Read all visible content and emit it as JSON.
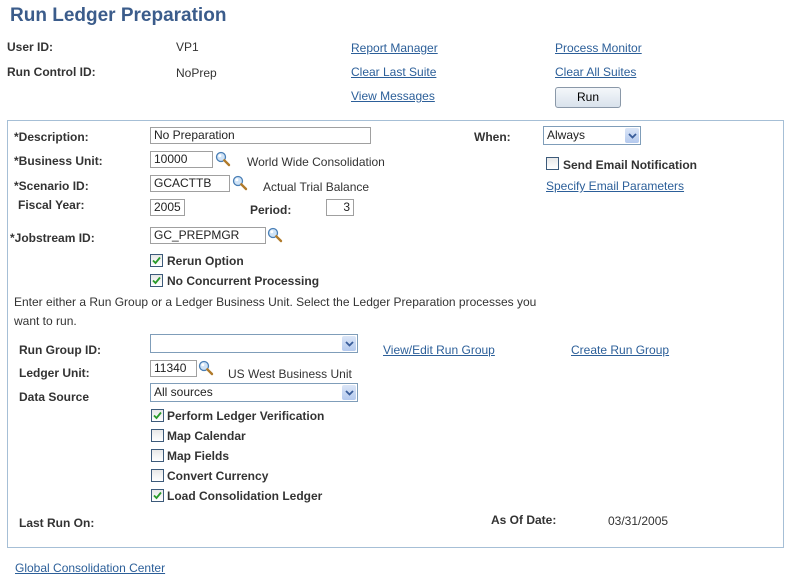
{
  "page": {
    "title": "Run Ledger Preparation"
  },
  "header": {
    "user_id_label": "User ID:",
    "user_id_value": "VP1",
    "run_control_label": "Run Control ID:",
    "run_control_value": "NoPrep",
    "links": {
      "report_manager": "Report Manager",
      "process_monitor": "Process Monitor",
      "clear_last_suite": "Clear Last Suite",
      "clear_all_suites": "Clear All Suites",
      "view_messages": "View Messages"
    },
    "run_button": "Run"
  },
  "form": {
    "description": {
      "label": "*Description:",
      "value": "No Preparation"
    },
    "business_unit": {
      "label": "*Business Unit:",
      "value": "10000",
      "description": "World Wide Consolidation"
    },
    "scenario_id": {
      "label": "*Scenario ID:",
      "value": "GCACTTB",
      "description": "Actual Trial Balance"
    },
    "fiscal_year": {
      "label": "Fiscal Year:",
      "value": "2005"
    },
    "period": {
      "label": "Period:",
      "value": "3"
    },
    "jobstream_id": {
      "label": "*Jobstream ID:",
      "value": "GC_PREPMGR"
    },
    "when": {
      "label": "When:",
      "value": "Always"
    },
    "send_email": {
      "label": "Send Email Notification",
      "checked": false
    },
    "specify_email_link": "Specify Email Parameters",
    "rerun_option": {
      "label": "Rerun Option",
      "checked": true
    },
    "no_concurrent": {
      "label": "No Concurrent Processing",
      "checked": true
    },
    "instructions": "Enter either a Run Group or a Ledger Business Unit. Select the Ledger Preparation processes you",
    "instructions_line2": "want to run.",
    "run_group_id": {
      "label": "Run Group ID:",
      "value": ""
    },
    "view_edit_run_group_link": "View/Edit Run Group",
    "create_run_group_link": "Create Run Group",
    "ledger_unit": {
      "label": "Ledger Unit:",
      "value": "11340",
      "description": "US West Business Unit"
    },
    "data_source": {
      "label": "Data Source",
      "value": "All sources"
    },
    "processes": [
      {
        "label": "Perform Ledger Verification",
        "checked": true
      },
      {
        "label": "Map Calendar",
        "checked": false
      },
      {
        "label": "Map Fields",
        "checked": false
      },
      {
        "label": "Convert Currency",
        "checked": false
      },
      {
        "label": "Load Consolidation Ledger",
        "checked": true
      }
    ],
    "last_run_on": {
      "label": "Last Run On:",
      "value": ""
    },
    "as_of_date": {
      "label": "As Of Date:",
      "value": "03/31/2005"
    }
  },
  "footer": {
    "global_consolidation_link": "Global Consolidation Center"
  },
  "colors": {
    "title": "#3b5c8b",
    "link": "#2c5f99",
    "box_border": "#a6bfd6",
    "check": "#2a9a2a"
  }
}
